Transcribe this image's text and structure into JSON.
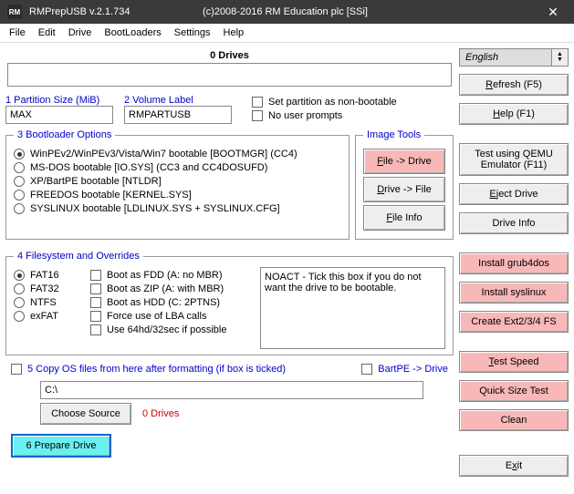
{
  "titlebar": {
    "app_icon": "RM",
    "title": "RMPrepUSB v.2.1.734",
    "subtitle": "(c)2008-2016 RM Education plc [SSi]"
  },
  "menu": {
    "file": "File",
    "edit": "Edit",
    "drive": "Drive",
    "bootloaders": "BootLoaders",
    "settings": "Settings",
    "help": "Help"
  },
  "drives": {
    "label": "0 Drives"
  },
  "fields": {
    "partition_size_label": "1 Partition Size (MiB)",
    "partition_size_value": "MAX",
    "volume_label_label": "2 Volume Label",
    "volume_label_value": "RMPARTUSB"
  },
  "opts": {
    "nonbootable": "Set partition as non-bootable",
    "noprompts": "No user prompts"
  },
  "boot": {
    "legend": "3 Bootloader Options",
    "o1": "WinPEv2/WinPEv3/Vista/Win7 bootable [BOOTMGR] (CC4)",
    "o2": "MS-DOS bootable [IO.SYS]    (CC3 and CC4DOSUFD)",
    "o3": "XP/BartPE bootable [NTLDR]",
    "o4": "FREEDOS bootable [KERNEL.SYS]",
    "o5": "SYSLINUX bootable [LDLINUX.SYS + SYSLINUX.CFG]"
  },
  "img": {
    "legend": "Image Tools",
    "b1": "File -> Drive",
    "b2": "Drive -> File",
    "b3": "File Info"
  },
  "fs": {
    "legend": "4 Filesystem and Overrides",
    "r1": "FAT16",
    "r2": "FAT32",
    "r3": "NTFS",
    "r4": "exFAT",
    "c1": "Boot as FDD (A: no MBR)",
    "c2": "Boot as ZIP (A: with MBR)",
    "c3": "Boot as HDD (C: 2PTNS)",
    "c4": "Force use of LBA calls",
    "c5": "Use 64hd/32sec if possible",
    "note": "NOACT - Tick this box if you do not want the drive to be bootable."
  },
  "copy": {
    "label": "5 Copy OS files from here after formatting (if box is ticked)",
    "bartpe": "BartPE -> Drive",
    "path": "C:\\",
    "choose": "Choose Source",
    "status": "0 Drives"
  },
  "prepare": "6 Prepare Drive",
  "side": {
    "lang": "English",
    "refresh": "Refresh (F5)",
    "help": "Help (F1)",
    "qemu_l1": "Test using QEMU",
    "qemu_l2": "Emulator (F11)",
    "eject": "Eject Drive",
    "dinfo": "Drive Info",
    "grub": "Install grub4dos",
    "syslinux": "Install syslinux",
    "ext": "Create Ext2/3/4 FS",
    "testspeed": "Test Speed",
    "qst": "Quick Size Test",
    "clean": "Clean",
    "exit": "Exit"
  }
}
